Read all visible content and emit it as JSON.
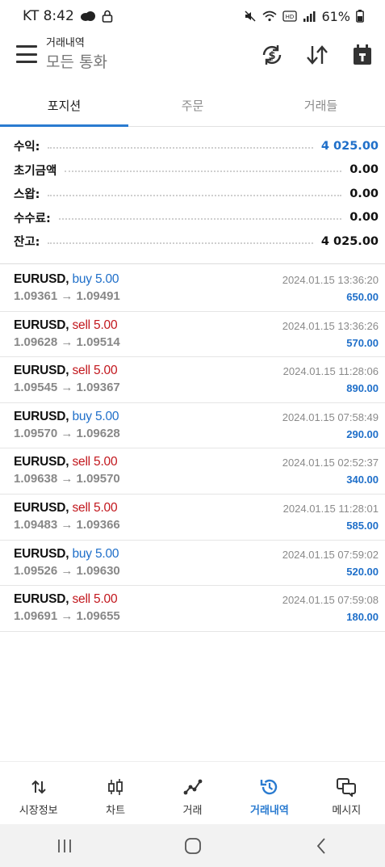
{
  "status_bar": {
    "carrier_time": "KT 8:42",
    "battery": "61%"
  },
  "app_bar": {
    "title": "거래내역",
    "subtitle": "모든 통화"
  },
  "tabs": [
    {
      "label": "포지션",
      "active": true
    },
    {
      "label": "주문",
      "active": false
    },
    {
      "label": "거래들",
      "active": false
    }
  ],
  "summary": [
    {
      "label": "수익:",
      "value": "4 025.00",
      "highlight": true
    },
    {
      "label": "초기금액",
      "value": "0.00",
      "highlight": false
    },
    {
      "label": "스왑:",
      "value": "0.00",
      "highlight": false
    },
    {
      "label": "수수료:",
      "value": "0.00",
      "highlight": false
    },
    {
      "label": "잔고:",
      "value": "4 025.00",
      "highlight": false
    }
  ],
  "trades": [
    {
      "symbol": "EURUSD,",
      "side": "buy",
      "side_label": "buy 5.00",
      "prices": "1.09361 → 1.09491",
      "time": "2024.01.15 13:36:20",
      "profit": "650.00"
    },
    {
      "symbol": "EURUSD,",
      "side": "sell",
      "side_label": "sell 5.00",
      "prices": "1.09628 → 1.09514",
      "time": "2024.01.15 13:36:26",
      "profit": "570.00"
    },
    {
      "symbol": "EURUSD,",
      "side": "sell",
      "side_label": "sell 5.00",
      "prices": "1.09545 → 1.09367",
      "time": "2024.01.15 11:28:06",
      "profit": "890.00"
    },
    {
      "symbol": "EURUSD,",
      "side": "buy",
      "side_label": "buy 5.00",
      "prices": "1.09570 → 1.09628",
      "time": "2024.01.15 07:58:49",
      "profit": "290.00"
    },
    {
      "symbol": "EURUSD,",
      "side": "sell",
      "side_label": "sell 5.00",
      "prices": "1.09638 → 1.09570",
      "time": "2024.01.15 02:52:37",
      "profit": "340.00"
    },
    {
      "symbol": "EURUSD,",
      "side": "sell",
      "side_label": "sell 5.00",
      "prices": "1.09483 → 1.09366",
      "time": "2024.01.15 11:28:01",
      "profit": "585.00"
    },
    {
      "symbol": "EURUSD,",
      "side": "buy",
      "side_label": "buy 5.00",
      "prices": "1.09526 → 1.09630",
      "time": "2024.01.15 07:59:02",
      "profit": "520.00"
    },
    {
      "symbol": "EURUSD,",
      "side": "sell",
      "side_label": "sell 5.00",
      "prices": "1.09691 → 1.09655",
      "time": "2024.01.15 07:59:08",
      "profit": "180.00"
    }
  ],
  "bottom_nav": [
    {
      "label": "시장정보",
      "icon": "quotes-icon",
      "active": false
    },
    {
      "label": "차트",
      "icon": "candlestick-icon",
      "active": false
    },
    {
      "label": "거래",
      "icon": "trade-icon",
      "active": false
    },
    {
      "label": "거래내역",
      "icon": "history-icon",
      "active": true
    },
    {
      "label": "메시지",
      "icon": "messages-icon",
      "active": false
    }
  ],
  "colors": {
    "accent": "#2a7bd0",
    "buy": "#1f6fc9",
    "sell": "#c2171d",
    "profit": "#1f6fc9"
  }
}
